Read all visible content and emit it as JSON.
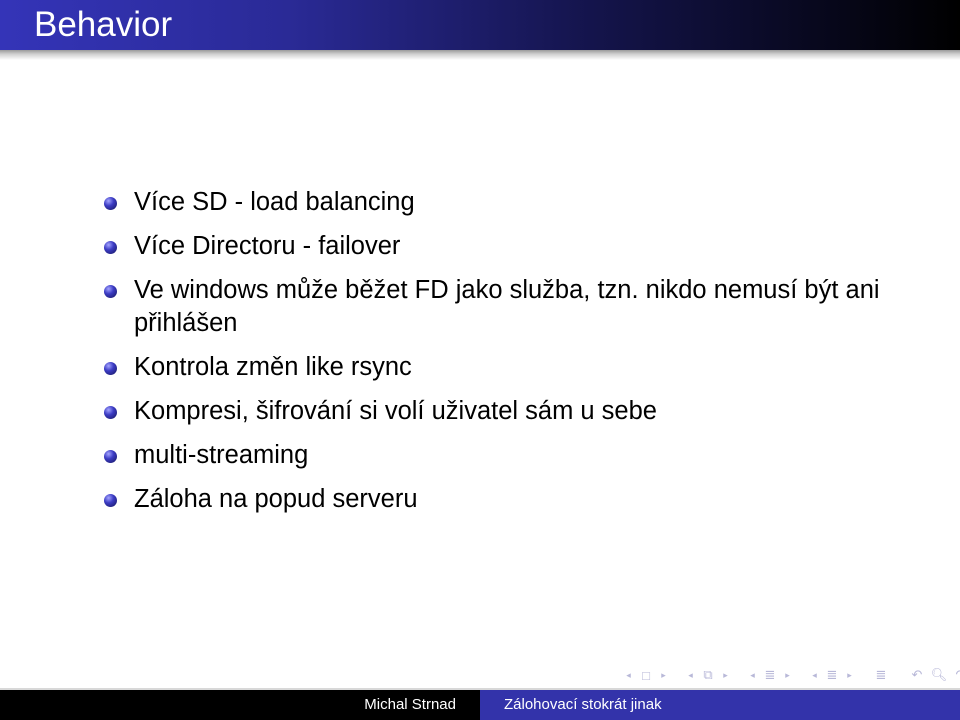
{
  "slide": {
    "title": "Behavior",
    "items": [
      {
        "text": "Více SD - load balancing"
      },
      {
        "text": "Více Directoru - failover"
      },
      {
        "text": "Ve windows může běžet FD jako služba, tzn. nikdo nemusí být ani přihlášen"
      },
      {
        "text": "Kontrola změn like rsync"
      },
      {
        "text": "Kompresi, šifrování si volí uživatel sám u sebe"
      },
      {
        "text": "multi-streaming"
      },
      {
        "text": "Záloha na popud serveru"
      }
    ]
  },
  "navigation": {
    "icons": [
      {
        "name": "prev-arrow",
        "glyph": "◂"
      },
      {
        "name": "frame-icon",
        "glyph": "□"
      },
      {
        "name": "next-arrow",
        "glyph": "▸"
      },
      {
        "name": "prev-arrow",
        "glyph": "◂"
      },
      {
        "name": "frames-icon",
        "glyph": "⧉"
      },
      {
        "name": "next-arrow",
        "glyph": "▸"
      },
      {
        "name": "prev-arrow",
        "glyph": "◂"
      },
      {
        "name": "subsection-icon",
        "glyph": "≣"
      },
      {
        "name": "next-arrow",
        "glyph": "▸"
      },
      {
        "name": "prev-arrow",
        "glyph": "◂"
      },
      {
        "name": "section-icon",
        "glyph": "≣"
      },
      {
        "name": "next-arrow",
        "glyph": "▸"
      },
      {
        "name": "align-icon",
        "glyph": "≣"
      },
      {
        "name": "undo-icon",
        "glyph": "↶"
      },
      {
        "name": "search-icon",
        "glyph": "🔍︎"
      },
      {
        "name": "redo-icon",
        "glyph": "↷"
      }
    ]
  },
  "footer": {
    "author": "Michal Strnad",
    "short_title": "Zálohovací stokrát jinak"
  },
  "colors": {
    "header_start": "#3434b8",
    "header_end": "#000000",
    "footer_left": "#000000",
    "footer_right": "#3333aa",
    "bullet": "#3c3cc4"
  }
}
